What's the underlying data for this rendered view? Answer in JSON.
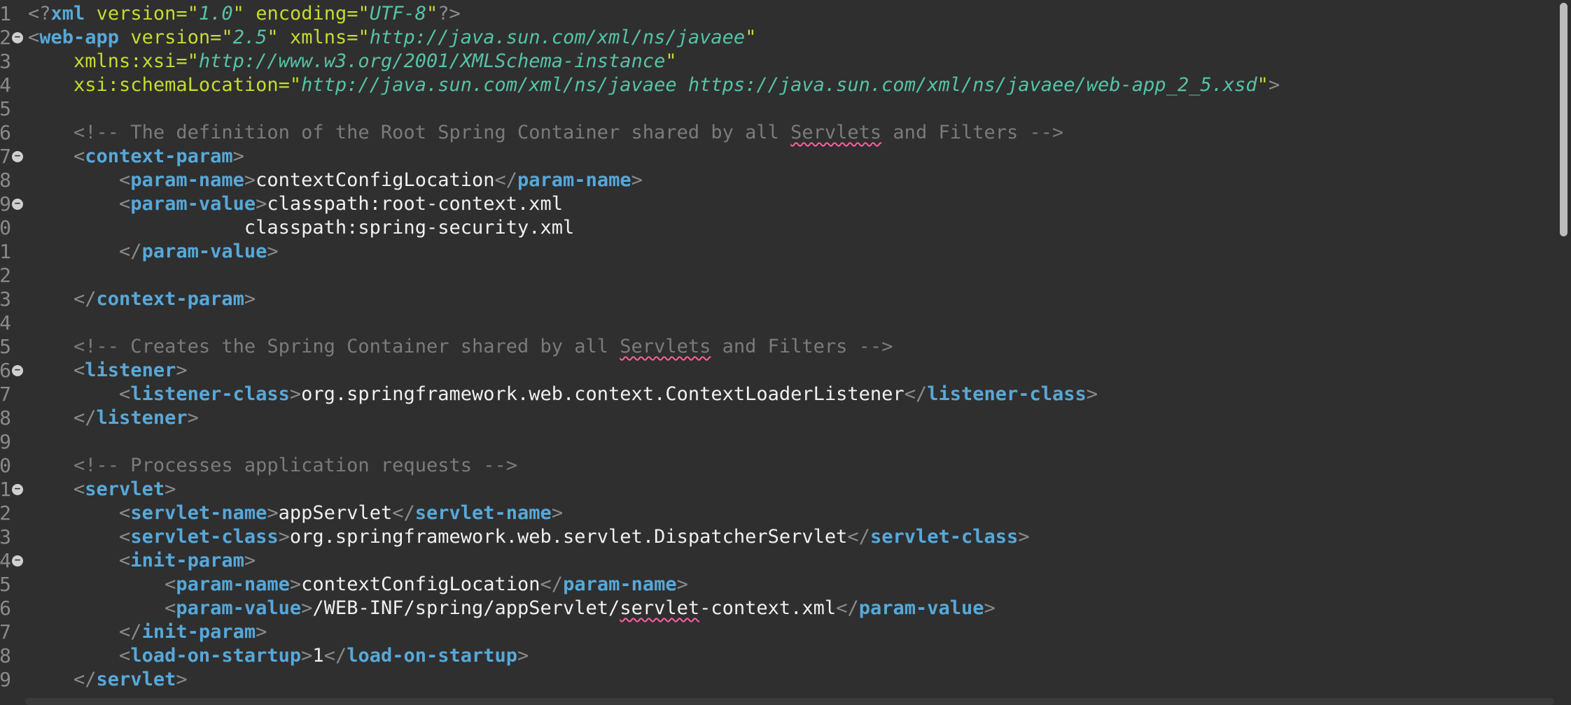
{
  "editor": {
    "gutter": {
      "line_numbers": [
        "1",
        "2",
        "3",
        "4",
        "5",
        "6",
        "7",
        "8",
        "9",
        "0",
        "1",
        "2",
        "3",
        "4",
        "5",
        "6",
        "7",
        "8",
        "9",
        "0",
        "1",
        "2",
        "3",
        "4",
        "5",
        "6",
        "7",
        "8",
        "9"
      ]
    },
    "code": {
      "l1": {
        "open": "<?",
        "name": "xml",
        "a1": "version",
        "eq1": "=\"",
        "v1": "1.0",
        "q1": "\"",
        "a2": "encoding",
        "eq2": "=\"",
        "v2": "UTF-8",
        "q2": "\"",
        "close": "?>"
      },
      "l2": {
        "open": "<",
        "name": "web-app",
        "a1": "version",
        "eq1": "=\"",
        "v1": "2.5",
        "q1": "\"",
        "a2": "xmlns",
        "eq2": "=\"",
        "v2": "http://java.sun.com/xml/ns/javaee",
        "q2": "\""
      },
      "l3": {
        "a": "xmlns:xsi",
        "eq": "=\"",
        "v": "http://www.w3.org/2001/XMLSchema-instance",
        "q": "\""
      },
      "l4": {
        "a": "xsi:schemaLocation",
        "eq": "=\"",
        "v": "http://java.sun.com/xml/ns/javaee https://java.sun.com/xml/ns/javaee/web-app_2_5.xsd",
        "q": "\"",
        "close": ">"
      },
      "l6": {
        "c1": "<!-- The definition of the Root Spring Container shared by all ",
        "sq": "Servlets",
        "c2": " and Filters -->"
      },
      "l7": {
        "open": "<",
        "name": "context-param",
        "close": ">"
      },
      "l8": {
        "open": "<",
        "name": "param-name",
        "close": ">",
        "text": "contextConfigLocation",
        "eopen": "</",
        "ename": "param-name",
        "eclose": ">"
      },
      "l9": {
        "open": "<",
        "name": "param-value",
        "close": ">",
        "text": "classpath:root-context.xml"
      },
      "l10": {
        "text": "classpath:spring-security.xml"
      },
      "l11": {
        "open": "</",
        "name": "param-value",
        "close": ">"
      },
      "l13": {
        "open": "</",
        "name": "context-param",
        "close": ">"
      },
      "l15": {
        "c1": "<!-- Creates the Spring Container shared by all ",
        "sq": "Servlets",
        "c2": " and Filters -->"
      },
      "l16": {
        "open": "<",
        "name": "listener",
        "close": ">"
      },
      "l17": {
        "open": "<",
        "name": "listener-class",
        "close": ">",
        "text": "org.springframework.web.context.ContextLoaderListener",
        "eopen": "</",
        "ename": "listener-class",
        "eclose": ">"
      },
      "l18": {
        "open": "</",
        "name": "listener",
        "close": ">"
      },
      "l20": {
        "c": "<!-- Processes application requests -->"
      },
      "l21": {
        "open": "<",
        "name": "servlet",
        "close": ">"
      },
      "l22": {
        "open": "<",
        "name": "servlet-name",
        "close": ">",
        "text": "appServlet",
        "eopen": "</",
        "ename": "servlet-name",
        "eclose": ">"
      },
      "l23": {
        "open": "<",
        "name": "servlet-class",
        "close": ">",
        "text": "org.springframework.web.servlet.DispatcherServlet",
        "eopen": "</",
        "ename": "servlet-class",
        "eclose": ">"
      },
      "l24": {
        "open": "<",
        "name": "init-param",
        "close": ">"
      },
      "l25": {
        "open": "<",
        "name": "param-name",
        "close": ">",
        "text": "contextConfigLocation",
        "eopen": "</",
        "ename": "param-name",
        "eclose": ">"
      },
      "l26": {
        "open": "<",
        "name": "param-value",
        "close": ">",
        "t1": "/WEB-INF/spring/appServlet/",
        "sq": "servlet",
        "t2": "-context.xml",
        "eopen": "</",
        "ename": "param-value",
        "eclose": ">"
      },
      "l27": {
        "open": "</",
        "name": "init-param",
        "close": ">"
      },
      "l28": {
        "open": "<",
        "name": "load-on-startup",
        "close": ">",
        "text": "1",
        "eopen": "</",
        "ename": "load-on-startup",
        "eclose": ">"
      },
      "l29": {
        "open": "</",
        "name": "servlet",
        "close": ">"
      }
    },
    "fold_marker": "−"
  }
}
